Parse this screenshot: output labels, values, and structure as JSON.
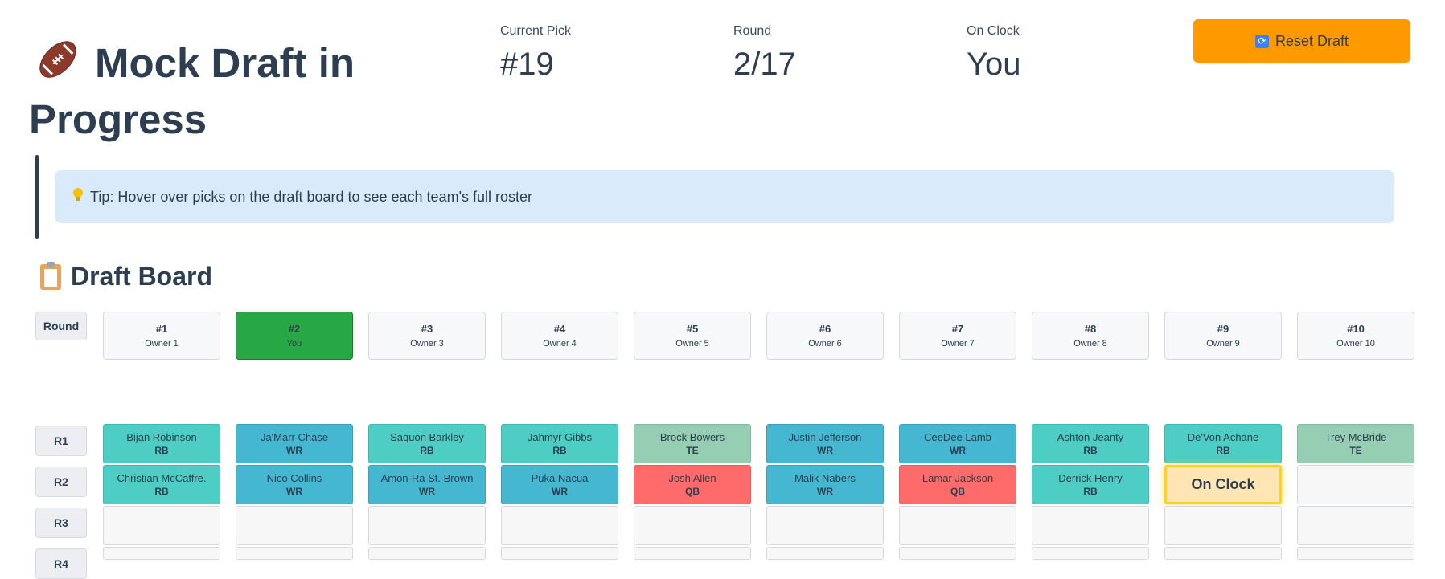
{
  "header": {
    "icon": "football-icon",
    "title_line1": "Mock Draft in",
    "title_line2": "Progress",
    "reset_label": "Reset Draft"
  },
  "metrics": [
    {
      "label": "Current Pick",
      "value": "#19"
    },
    {
      "label": "Round",
      "value": "2/17"
    },
    {
      "label": "On Clock",
      "value": "You"
    }
  ],
  "tip": {
    "text": "Tip: Hover over picks on the draft board to see each team's full roster"
  },
  "board": {
    "title": "Draft Board",
    "round_header": "Round",
    "teams": [
      {
        "num": "#1",
        "owner": "Owner 1"
      },
      {
        "num": "#2",
        "owner": "You"
      },
      {
        "num": "#3",
        "owner": "Owner 3"
      },
      {
        "num": "#4",
        "owner": "Owner 4"
      },
      {
        "num": "#5",
        "owner": "Owner 5"
      },
      {
        "num": "#6",
        "owner": "Owner 6"
      },
      {
        "num": "#7",
        "owner": "Owner 7"
      },
      {
        "num": "#8",
        "owner": "Owner 8"
      },
      {
        "num": "#9",
        "owner": "Owner 9"
      },
      {
        "num": "#10",
        "owner": "Owner 10"
      }
    ],
    "rounds": [
      "R1",
      "R2",
      "R3",
      "R4"
    ],
    "picks": {
      "r1": [
        {
          "name": "Bijan Robinson",
          "pos": "RB"
        },
        {
          "name": "Ja'Marr Chase",
          "pos": "WR"
        },
        {
          "name": "Saquon Barkley",
          "pos": "RB"
        },
        {
          "name": "Jahmyr Gibbs",
          "pos": "RB"
        },
        {
          "name": "Brock Bowers",
          "pos": "TE"
        },
        {
          "name": "Justin Jefferson",
          "pos": "WR"
        },
        {
          "name": "CeeDee Lamb",
          "pos": "WR"
        },
        {
          "name": "Ashton Jeanty",
          "pos": "RB"
        },
        {
          "name": "De'Von Achane",
          "pos": "RB"
        },
        {
          "name": "Trey McBride",
          "pos": "TE"
        }
      ],
      "r2": [
        {
          "name": "Christian McCaffre.",
          "pos": "RB"
        },
        {
          "name": "Nico Collins",
          "pos": "WR"
        },
        {
          "name": "Amon-Ra St. Brown",
          "pos": "WR"
        },
        {
          "name": "Puka Nacua",
          "pos": "WR"
        },
        {
          "name": "Josh Allen",
          "pos": "QB"
        },
        {
          "name": "Malik Nabers",
          "pos": "WR"
        },
        {
          "name": "Lamar Jackson",
          "pos": "QB"
        },
        {
          "name": "Derrick Henry",
          "pos": "RB"
        }
      ],
      "on_clock_label": "On Clock"
    },
    "position_colors": {
      "RB": "#4ecdc4",
      "WR": "#45b7d1",
      "TE": "#96ceb4",
      "QB": "#ff6b6b"
    }
  }
}
